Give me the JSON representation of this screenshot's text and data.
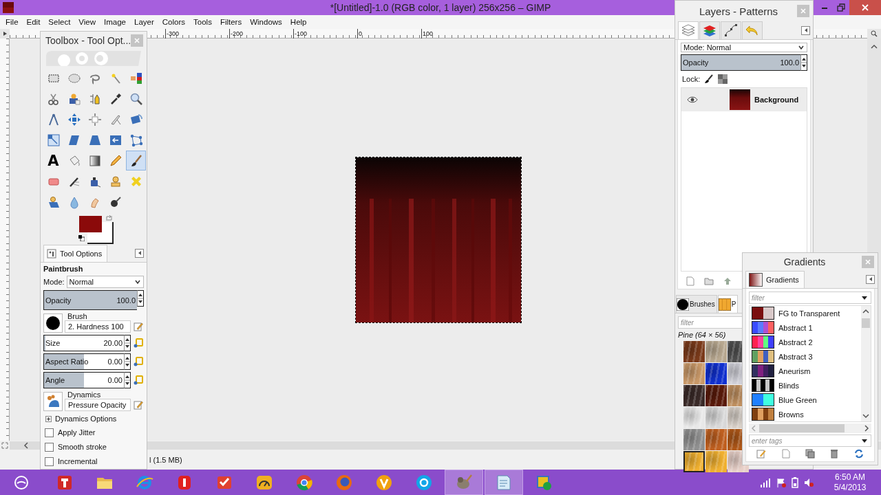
{
  "window": {
    "title": "*[Untitled]-1.0 (RGB color, 1 layer) 256x256 – GIMP"
  },
  "menu": [
    "File",
    "Edit",
    "Select",
    "View",
    "Image",
    "Layer",
    "Colors",
    "Tools",
    "Filters",
    "Windows",
    "Help"
  ],
  "ruler": {
    "labels": [
      "-300",
      "-200",
      "-100",
      "0",
      "100"
    ]
  },
  "status_bar": {
    "text": "l (1.5 MB)"
  },
  "toolbox": {
    "title": "Toolbox - Tool Opt...",
    "tools": [
      {
        "kind": "rect_select",
        "selected": false
      },
      {
        "kind": "ellipse_select",
        "selected": false
      },
      {
        "kind": "lasso",
        "selected": false
      },
      {
        "kind": "wand",
        "selected": false
      },
      {
        "kind": "color_select",
        "selected": false
      },
      {
        "kind": "scissors",
        "selected": false
      },
      {
        "kind": "fg_select",
        "selected": false
      },
      {
        "kind": "paths",
        "selected": false
      },
      {
        "kind": "picker",
        "selected": false
      },
      {
        "kind": "zoom",
        "selected": false
      },
      {
        "kind": "measure",
        "selected": false
      },
      {
        "kind": "move",
        "selected": false
      },
      {
        "kind": "align",
        "selected": false
      },
      {
        "kind": "crop",
        "selected": false
      },
      {
        "kind": "rotate",
        "selected": false
      },
      {
        "kind": "scale",
        "selected": false
      },
      {
        "kind": "shear",
        "selected": false
      },
      {
        "kind": "perspective",
        "selected": false
      },
      {
        "kind": "flip",
        "selected": false
      },
      {
        "kind": "cage",
        "selected": false
      },
      {
        "kind": "text",
        "glyph": "A",
        "selected": false
      },
      {
        "kind": "bucket",
        "selected": false
      },
      {
        "kind": "blend",
        "selected": false
      },
      {
        "kind": "pencil",
        "selected": false
      },
      {
        "kind": "brush",
        "selected": true
      },
      {
        "kind": "eraser",
        "selected": false
      },
      {
        "kind": "airbrush",
        "selected": false
      },
      {
        "kind": "ink",
        "selected": false
      },
      {
        "kind": "clone",
        "selected": false
      },
      {
        "kind": "heal",
        "selected": false
      },
      {
        "kind": "persp_clone",
        "selected": false
      },
      {
        "kind": "blur",
        "selected": false
      },
      {
        "kind": "smudge",
        "selected": false
      },
      {
        "kind": "dodge",
        "selected": false
      }
    ],
    "colors": {
      "foreground": {
        "color": "#8b0a0a"
      },
      "background": {
        "color": "#ffffff"
      }
    }
  },
  "tool_options": {
    "tab": "Tool Options",
    "tool": "Paintbrush",
    "mode_label": "Mode:",
    "mode": "Normal",
    "opacity": {
      "label": "Opacity",
      "value": "100.0",
      "level": 1
    },
    "brush": {
      "label": "Brush",
      "value": "2. Hardness 100"
    },
    "sliders": [
      {
        "label": "Size",
        "value": "20.00",
        "level": 0.02
      },
      {
        "label": "Aspect Ratio",
        "value": "0.00",
        "level": 0.5
      },
      {
        "label": "Angle",
        "value": "0.00",
        "level": 0.5
      }
    ],
    "dynamics": {
      "label": "Dynamics",
      "value": "Pressure Opacity"
    },
    "expander": {
      "label": "Dynamics Options",
      "expanded": false
    },
    "checkboxes": [
      {
        "label": "Apply Jitter",
        "checked": false
      },
      {
        "label": "Smooth stroke",
        "checked": false
      },
      {
        "label": "Incremental",
        "checked": false
      }
    ]
  },
  "layers_dock": {
    "title": "Layers - Patterns",
    "tabs": [
      {
        "kind": "layers",
        "selected": true
      },
      {
        "kind": "channels",
        "selected": false
      },
      {
        "kind": "paths",
        "selected": false
      },
      {
        "kind": "undo",
        "selected": false
      }
    ],
    "mode": "Mode: Normal",
    "opacity": {
      "label": "Opacity",
      "value": "100.0",
      "level": 1
    },
    "lock_label": "Lock:",
    "layers": [
      {
        "name": "Background",
        "visible": true,
        "selected": true
      }
    ]
  },
  "patterns_dock": {
    "tabs": [
      {
        "kind": "brushes",
        "label": "Brushes",
        "selected": false
      },
      {
        "kind": "patterns",
        "label": "P",
        "selected": true
      }
    ],
    "filter_placeholder": "filter",
    "caption": "Pine (64 × 56)",
    "patterns": [
      {
        "color": "#7a3a1a",
        "selected": false
      },
      {
        "color": "#b8a890",
        "selected": false
      },
      {
        "color": "#505050",
        "selected": false
      },
      {
        "color": "#c89868",
        "selected": false
      },
      {
        "color": "#1030d0",
        "selected": false
      },
      {
        "color": "#d0d0d8",
        "selected": false
      },
      {
        "color": "#3a2a28",
        "selected": false
      },
      {
        "color": "#5a1a0a",
        "selected": false
      },
      {
        "color": "#c09060",
        "selected": false
      },
      {
        "color": "#e8e8e8",
        "selected": false
      },
      {
        "color": "#d8d8d8",
        "selected": false
      },
      {
        "color": "#d8d0c8",
        "selected": false
      },
      {
        "color": "#909090",
        "selected": false
      },
      {
        "color": "#c06020",
        "selected": false
      },
      {
        "color": "#b05818",
        "selected": false
      },
      {
        "color": "#f0b030",
        "selected": true
      },
      {
        "color": "#f0b030",
        "selected": false
      },
      {
        "color": "#e8d0c8",
        "selected": false
      }
    ]
  },
  "gradients": {
    "title": "Gradients",
    "tab": "Gradients",
    "filter_placeholder": "filter",
    "tags_placeholder": "enter tags",
    "items": [
      {
        "name": "FG to Transparent",
        "stops": [
          {
            "color": "#7a0f0f"
          },
          {
            "color": "#d8c8c8"
          }
        ]
      },
      {
        "name": "Abstract 1",
        "stops": [
          {
            "color": "#3a4bff"
          },
          {
            "color": "#5a7cff"
          },
          {
            "color": "#b050d0"
          },
          {
            "color": "#ff6060"
          }
        ]
      },
      {
        "name": "Abstract 2",
        "stops": [
          {
            "color": "#ff2050"
          },
          {
            "color": "#ff40a0"
          },
          {
            "color": "#60ff80"
          },
          {
            "color": "#4040ff"
          }
        ]
      },
      {
        "name": "Abstract 3",
        "stops": [
          {
            "color": "#60a060"
          },
          {
            "color": "#e0a060"
          },
          {
            "color": "#4060c0"
          },
          {
            "color": "#e0c080"
          }
        ]
      },
      {
        "name": "Aneurism",
        "stops": [
          {
            "color": "#303060"
          },
          {
            "color": "#802080"
          },
          {
            "color": "#402060"
          },
          {
            "color": "#202040"
          }
        ]
      },
      {
        "name": "Blinds",
        "stops": [
          {
            "color": "#000000"
          },
          {
            "color": "#c8c8c8"
          },
          {
            "color": "#000000"
          },
          {
            "color": "#c8c8c8"
          },
          {
            "color": "#000000"
          }
        ]
      },
      {
        "name": "Blue Green",
        "stops": [
          {
            "color": "#2080ff"
          },
          {
            "color": "#40ffe0"
          }
        ]
      },
      {
        "name": "Browns",
        "stops": [
          {
            "color": "#804010"
          },
          {
            "color": "#e0a060"
          },
          {
            "color": "#804010"
          },
          {
            "color": "#c08040"
          }
        ]
      }
    ]
  },
  "taskbar": {
    "apps": [
      {
        "kind": "tile",
        "active": false
      },
      {
        "kind": "folder",
        "active": false
      },
      {
        "kind": "ie",
        "active": false
      },
      {
        "kind": "dollar",
        "active": false
      },
      {
        "kind": "todo",
        "active": false
      },
      {
        "kind": "gauge",
        "active": false
      },
      {
        "kind": "chrome",
        "active": false
      },
      {
        "kind": "firefox",
        "active": false
      },
      {
        "kind": "v",
        "active": false
      },
      {
        "kind": "skype",
        "active": false
      },
      {
        "kind": "gimp",
        "active": true
      },
      {
        "kind": "notes",
        "active": true
      },
      {
        "kind": "other",
        "active": false
      }
    ],
    "clock": {
      "time": "6:50 AM",
      "date": "5/4/2013"
    }
  }
}
